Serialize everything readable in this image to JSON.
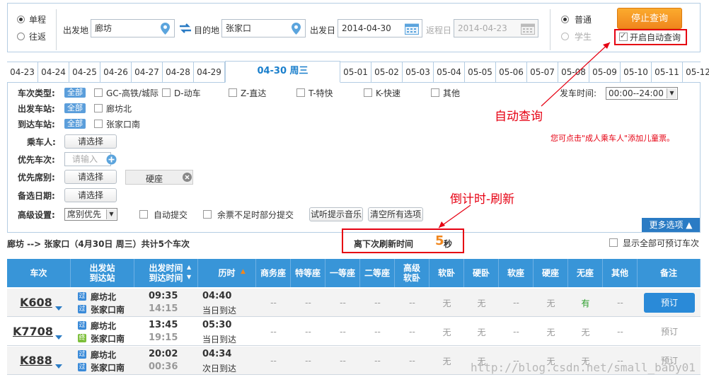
{
  "search": {
    "trip_types": [
      {
        "label": "单程",
        "selected": true
      },
      {
        "label": "往返",
        "selected": false
      }
    ],
    "from_label": "出发地",
    "from_value": "廊坊",
    "to_label": "目的地",
    "to_value": "张家口",
    "date_label": "出发日",
    "date_value": "2014-04-30",
    "return_label": "返程日",
    "return_value": "2014-04-23",
    "passenger_types": [
      {
        "label": "普通",
        "selected": true
      },
      {
        "label": "学生",
        "selected": false
      }
    ],
    "stop_button": "停止查询",
    "auto_query_label": "开启自动查询"
  },
  "date_tabs": [
    "04-23",
    "04-24",
    "04-25",
    "04-26",
    "04-27",
    "04-28",
    "04-29",
    "04-30 周三",
    "05-01",
    "05-02",
    "05-03",
    "05-04",
    "05-05",
    "05-06",
    "05-07",
    "05-08",
    "05-09",
    "05-10",
    "05-11",
    "05-12"
  ],
  "active_tab": "04-30 周三",
  "filters": {
    "type_label": "车次类型:",
    "all": "全部",
    "types": [
      "GC-高铁/城际",
      "D-动车",
      "Z-直达",
      "T-特快",
      "K-快速",
      "其他"
    ],
    "depart_station_label": "出发车站:",
    "depart_station": "廊坊北",
    "arrive_station_label": "到达车站:",
    "arrive_station": "张家口南",
    "passenger_label": "乘车人:",
    "choose": "请选择",
    "priority_train_label": "优先车次:",
    "priority_train_placeholder": "请输入",
    "priority_seat_label": "优先席别:",
    "seat_tag": "硬座",
    "alt_date_label": "备选日期:",
    "advanced_label": "高级设置:",
    "advanced_select": "席别优先",
    "auto_submit": "自动提交",
    "partial_submit": "余票不足时部分提交",
    "music_button": "试听提示音乐",
    "clear_button": "清空所有选项",
    "depart_time_label": "发车时间:",
    "depart_time_value": "00:00--24:00",
    "more_options": "更多选项"
  },
  "annotations": {
    "auto_query": "自动查询",
    "child_ticket_hint": "您可点击\"成人乘车人\"添加儿童票。",
    "countdown": "倒计时-刷新"
  },
  "info": {
    "route": "廊坊 --> 张家口（4月30日 周三）共计",
    "count": "5",
    "count_suffix": "个车次",
    "refresh_label": "离下次刷新时间",
    "refresh_seconds": "5",
    "refresh_unit": "秒",
    "show_all": "显示全部可预订车次"
  },
  "table_headers": [
    "车次",
    "出发站\n到达站",
    "出发时间\n到达时间",
    "历时",
    "商务座",
    "特等座",
    "一等座",
    "二等座",
    "高级\n软卧",
    "软卧",
    "硬卧",
    "软座",
    "硬座",
    "无座",
    "其他",
    "备注"
  ],
  "trains": [
    {
      "no": "K608",
      "from": "廊坊北",
      "to": "张家口南",
      "from_badge": "过",
      "to_badge": "过",
      "dep": "09:35",
      "arr": "14:15",
      "dur": "04:40",
      "note": "当日到达",
      "seats": [
        "--",
        "--",
        "--",
        "--",
        "--",
        "无",
        "无",
        "--",
        "无",
        "有",
        "--"
      ],
      "book": "预订",
      "bookable": true
    },
    {
      "no": "K7708",
      "from": "廊坊北",
      "to": "张家口南",
      "from_badge": "过",
      "to_badge": "终",
      "dep": "13:45",
      "arr": "19:15",
      "dur": "05:30",
      "note": "当日到达",
      "seats": [
        "--",
        "--",
        "--",
        "--",
        "--",
        "无",
        "无",
        "--",
        "无",
        "无",
        "--"
      ],
      "book": "预订",
      "bookable": false
    },
    {
      "no": "K888",
      "from": "廊坊北",
      "to": "张家口南",
      "from_badge": "过",
      "to_badge": "过",
      "dep": "20:02",
      "arr": "00:36",
      "dur": "04:34",
      "note": "次日到达",
      "seats": [
        "--",
        "--",
        "--",
        "--",
        "--",
        "无",
        "无",
        "--",
        "无",
        "无",
        "--"
      ],
      "book": "预订",
      "bookable": false
    }
  ],
  "watermark": "http://blog.csdn.net/small_baby01",
  "colors": {
    "accent": "#3895d8",
    "orange": "#f0861d",
    "annotation": "#e60012",
    "available": "#2a9d2a"
  }
}
